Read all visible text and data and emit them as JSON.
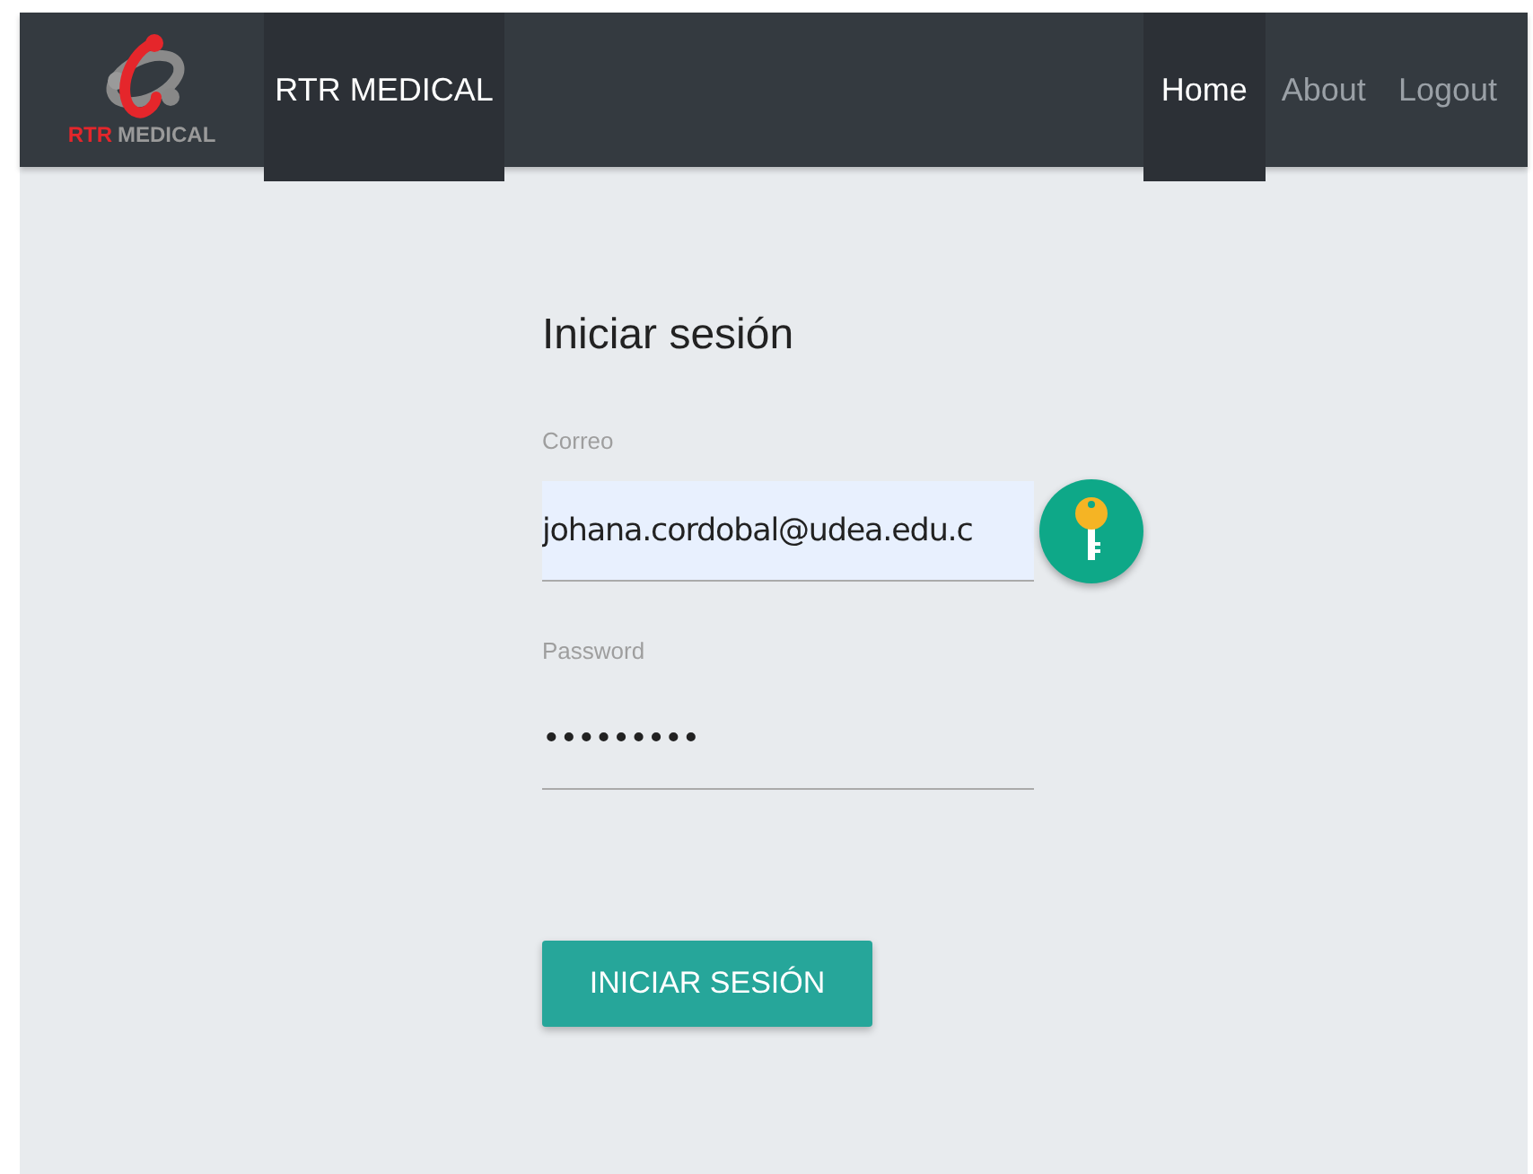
{
  "navbar": {
    "logo": {
      "accent": "RTR",
      "text": "MEDICAL"
    },
    "brand": "RTR MEDICAL",
    "links": [
      {
        "label": "Home",
        "selected": true
      },
      {
        "label": "About",
        "selected": false
      },
      {
        "label": "Logout",
        "selected": false
      }
    ]
  },
  "form": {
    "title": "Iniciar sesión",
    "fields": [
      {
        "label": "Correo",
        "value": "johana.cordobal@udea.edu.c",
        "autofilled": true
      },
      {
        "label": "Password",
        "value": "•••••••••",
        "autofilled": false
      }
    ],
    "submit": "INICIAR SESIÓN"
  }
}
